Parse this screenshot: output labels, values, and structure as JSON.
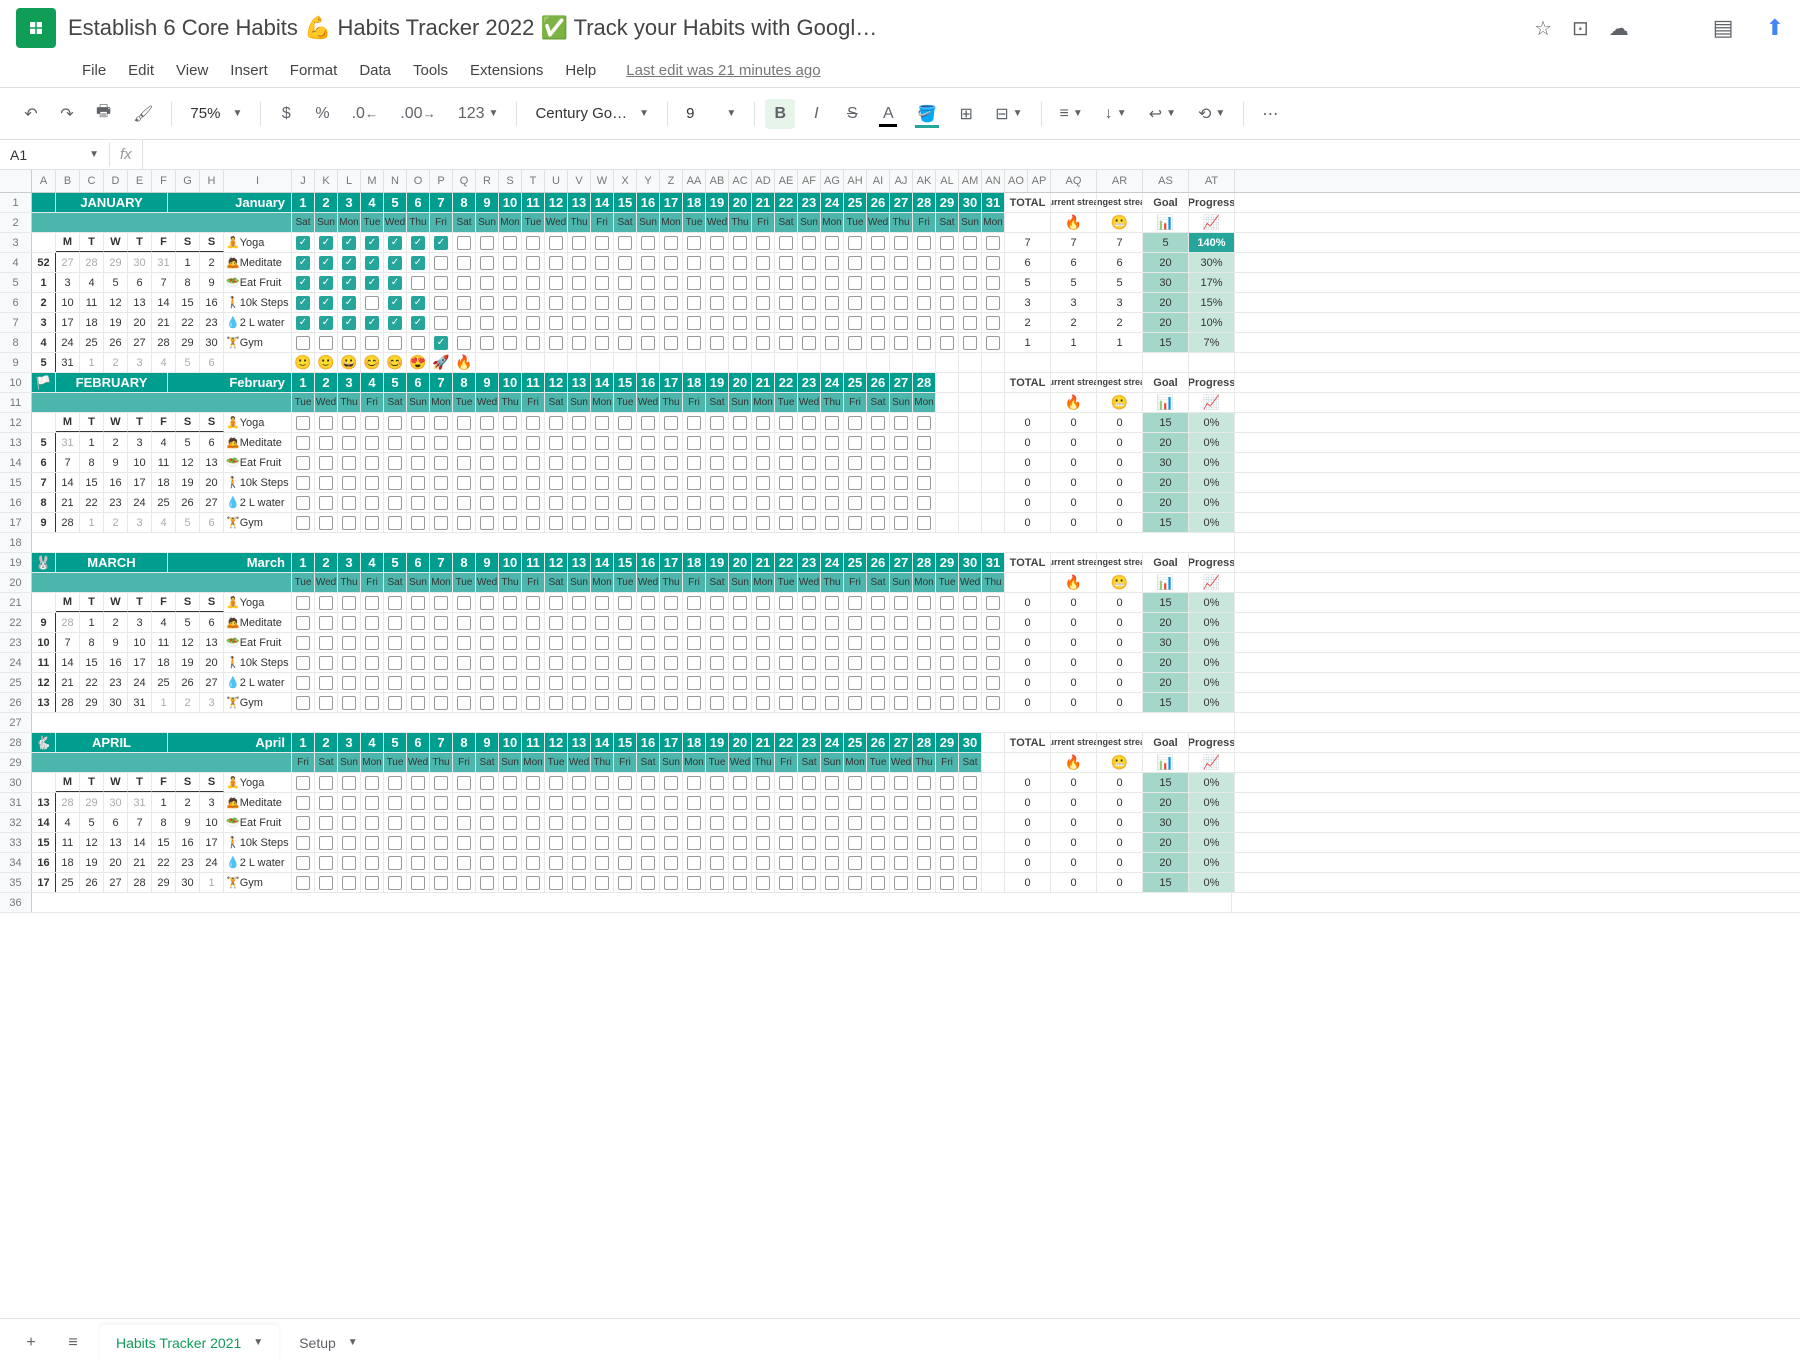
{
  "title": "Establish 6 Core Habits 💪 Habits Tracker 2022 ✅ Track your Habits with Googl…",
  "menu": [
    "File",
    "Edit",
    "View",
    "Insert",
    "Format",
    "Data",
    "Tools",
    "Extensions",
    "Help"
  ],
  "last_edit": "Last edit was 21 minutes ago",
  "toolbar": {
    "zoom": "75%",
    "font": "Century Go…",
    "size": "9",
    "fmt": "123"
  },
  "cell_ref": "A1",
  "columns": [
    "A",
    "B",
    "C",
    "D",
    "E",
    "F",
    "G",
    "H",
    "I",
    "J",
    "K",
    "L",
    "M",
    "N",
    "O",
    "P",
    "Q",
    "R",
    "S",
    "T",
    "U",
    "V",
    "W",
    "X",
    "Y",
    "Z",
    "AA",
    "AB",
    "AC",
    "AD",
    "AE",
    "AF",
    "AG",
    "AH",
    "AI",
    "AJ",
    "AK",
    "AL",
    "AM",
    "AN",
    "AO",
    "AP",
    "AQ",
    "AR",
    "AS",
    "AT"
  ],
  "wk_days": [
    "M",
    "T",
    "W",
    "T",
    "F",
    "S",
    "S"
  ],
  "stat_hdrs": {
    "total": "TOTAL",
    "cur": "current streak",
    "lng": "longest streak",
    "goal": "Goal",
    "prog": "Progress"
  },
  "stat_icons": {
    "cur": "🔥",
    "lng": "😬",
    "goal": "📊",
    "prog": "📈"
  },
  "months": [
    {
      "name": "JANUARY",
      "label": "January",
      "icon": "",
      "days": 31,
      "date_row": [
        "1",
        "2",
        "3",
        "4",
        "5",
        "6",
        "7",
        "8",
        "9",
        "10",
        "11",
        "12",
        "13",
        "14",
        "15",
        "16",
        "17",
        "18",
        "19",
        "20",
        "21",
        "22",
        "23",
        "24",
        "25",
        "26",
        "27",
        "28",
        "29",
        "30",
        "31"
      ],
      "dow_row": [
        "Sat",
        "Sun",
        "Mon",
        "Tue",
        "Wed",
        "Thu",
        "Fri",
        "Sat",
        "Sun",
        "Mon",
        "Tue",
        "Wed",
        "Thu",
        "Fri",
        "Sat",
        "Sun",
        "Mon",
        "Tue",
        "Wed",
        "Thu",
        "Fri",
        "Sat",
        "Sun",
        "Mon",
        "Tue",
        "Wed",
        "Thu",
        "Fri",
        "Sat",
        "Sun",
        "Mon"
      ],
      "cal": [
        [
          "52",
          "27",
          "28",
          "29",
          "30",
          "31",
          "1",
          "2"
        ],
        [
          "1",
          "3",
          "4",
          "5",
          "6",
          "7",
          "8",
          "9"
        ],
        [
          "2",
          "10",
          "11",
          "12",
          "13",
          "14",
          "15",
          "16"
        ],
        [
          "3",
          "17",
          "18",
          "19",
          "20",
          "21",
          "22",
          "23"
        ],
        [
          "4",
          "24",
          "25",
          "26",
          "27",
          "28",
          "29",
          "30"
        ],
        [
          "5",
          "31",
          "1",
          "2",
          "3",
          "4",
          "5",
          "6"
        ]
      ],
      "cal_grey": [
        [
          1,
          2,
          3,
          4,
          5
        ],
        [],
        [],
        [],
        [],
        [
          2,
          3,
          4,
          5,
          6,
          7
        ]
      ],
      "habits": [
        {
          "icon": "🧘",
          "name": "Yoga",
          "checks": 7,
          "total": 7,
          "cur": 7,
          "lng": 7,
          "goal": 5,
          "prog": "140%",
          "hi": true
        },
        {
          "icon": "🙇",
          "name": "Meditate",
          "checks": 6,
          "total": 6,
          "cur": 6,
          "lng": 6,
          "goal": 20,
          "prog": "30%"
        },
        {
          "icon": "🥗",
          "name": "Eat Fruit",
          "checks": 5,
          "total": 5,
          "cur": 5,
          "lng": 5,
          "goal": 30,
          "prog": "17%"
        },
        {
          "icon": "🚶",
          "name": "10k Steps",
          "checks": 6,
          "skip": [
            3
          ],
          "total": 3,
          "cur": 3,
          "lng": 3,
          "goal": 20,
          "prog": "15%"
        },
        {
          "icon": "💧",
          "name": "2 L water",
          "checks": 6,
          "total": 2,
          "cur": 2,
          "lng": 2,
          "goal": 20,
          "prog": "10%"
        },
        {
          "icon": "🏋️",
          "name": "Gym",
          "checks": 7,
          "only": [
            6
          ],
          "total": 1,
          "cur": 1,
          "lng": 1,
          "goal": 15,
          "prog": "7%"
        }
      ],
      "emoji_row": [
        "🙂",
        "🙂",
        "😀",
        "😊",
        "😊",
        "😍",
        "🚀",
        "🔥"
      ]
    },
    {
      "name": "FEBRUARY",
      "label": "February",
      "icon": "🏳️",
      "days": 28,
      "date_row": [
        "1",
        "2",
        "3",
        "4",
        "5",
        "6",
        "7",
        "8",
        "9",
        "10",
        "11",
        "12",
        "13",
        "14",
        "15",
        "16",
        "17",
        "18",
        "19",
        "20",
        "21",
        "22",
        "23",
        "24",
        "25",
        "26",
        "27",
        "28"
      ],
      "dow_row": [
        "Tue",
        "Wed",
        "Thu",
        "Fri",
        "Sat",
        "Sun",
        "Mon",
        "Tue",
        "Wed",
        "Thu",
        "Fri",
        "Sat",
        "Sun",
        "Mon",
        "Tue",
        "Wed",
        "Thu",
        "Fri",
        "Sat",
        "Sun",
        "Mon",
        "Tue",
        "Wed",
        "Thu",
        "Fri",
        "Sat",
        "Sun",
        "Mon"
      ],
      "cal": [
        [
          "5",
          "31",
          "1",
          "2",
          "3",
          "4",
          "5",
          "6"
        ],
        [
          "6",
          "7",
          "8",
          "9",
          "10",
          "11",
          "12",
          "13"
        ],
        [
          "7",
          "14",
          "15",
          "16",
          "17",
          "18",
          "19",
          "20"
        ],
        [
          "8",
          "21",
          "22",
          "23",
          "24",
          "25",
          "26",
          "27"
        ],
        [
          "9",
          "28",
          "1",
          "2",
          "3",
          "4",
          "5",
          "6"
        ]
      ],
      "cal_grey": [
        [
          1
        ],
        [],
        [],
        [],
        [
          2,
          3,
          4,
          5,
          6,
          7
        ]
      ],
      "habits": [
        {
          "icon": "🧘",
          "name": "Yoga",
          "checks": 0,
          "total": 0,
          "cur": 0,
          "lng": 0,
          "goal": 15,
          "prog": "0%"
        },
        {
          "icon": "🙇",
          "name": "Meditate",
          "checks": 0,
          "total": 0,
          "cur": 0,
          "lng": 0,
          "goal": 20,
          "prog": "0%"
        },
        {
          "icon": "🥗",
          "name": "Eat Fruit",
          "checks": 0,
          "total": 0,
          "cur": 0,
          "lng": 0,
          "goal": 30,
          "prog": "0%"
        },
        {
          "icon": "🚶",
          "name": "10k Steps",
          "checks": 0,
          "total": 0,
          "cur": 0,
          "lng": 0,
          "goal": 20,
          "prog": "0%"
        },
        {
          "icon": "💧",
          "name": "2 L water",
          "checks": 0,
          "total": 0,
          "cur": 0,
          "lng": 0,
          "goal": 20,
          "prog": "0%"
        },
        {
          "icon": "🏋️",
          "name": "Gym",
          "checks": 0,
          "total": 0,
          "cur": 0,
          "lng": 0,
          "goal": 15,
          "prog": "0%"
        }
      ]
    },
    {
      "name": "MARCH",
      "label": "March",
      "icon": "🐰",
      "days": 31,
      "date_row": [
        "1",
        "2",
        "3",
        "4",
        "5",
        "6",
        "7",
        "8",
        "9",
        "10",
        "11",
        "12",
        "13",
        "14",
        "15",
        "16",
        "17",
        "18",
        "19",
        "20",
        "21",
        "22",
        "23",
        "24",
        "25",
        "26",
        "27",
        "28",
        "29",
        "30",
        "31"
      ],
      "dow_row": [
        "Tue",
        "Wed",
        "Thu",
        "Fri",
        "Sat",
        "Sun",
        "Mon",
        "Tue",
        "Wed",
        "Thu",
        "Fri",
        "Sat",
        "Sun",
        "Mon",
        "Tue",
        "Wed",
        "Thu",
        "Fri",
        "Sat",
        "Sun",
        "Mon",
        "Tue",
        "Wed",
        "Thu",
        "Fri",
        "Sat",
        "Sun",
        "Mon",
        "Tue",
        "Wed",
        "Thu"
      ],
      "cal": [
        [
          "9",
          "28",
          "1",
          "2",
          "3",
          "4",
          "5",
          "6"
        ],
        [
          "10",
          "7",
          "8",
          "9",
          "10",
          "11",
          "12",
          "13"
        ],
        [
          "11",
          "14",
          "15",
          "16",
          "17",
          "18",
          "19",
          "20"
        ],
        [
          "12",
          "21",
          "22",
          "23",
          "24",
          "25",
          "26",
          "27"
        ],
        [
          "13",
          "28",
          "29",
          "30",
          "31",
          "1",
          "2",
          "3"
        ]
      ],
      "cal_grey": [
        [
          1
        ],
        [],
        [],
        [],
        [
          5,
          6,
          7
        ]
      ],
      "habits": [
        {
          "icon": "🧘",
          "name": "Yoga",
          "checks": 0,
          "total": 0,
          "cur": 0,
          "lng": 0,
          "goal": 15,
          "prog": "0%"
        },
        {
          "icon": "🙇",
          "name": "Meditate",
          "checks": 0,
          "total": 0,
          "cur": 0,
          "lng": 0,
          "goal": 20,
          "prog": "0%"
        },
        {
          "icon": "🥗",
          "name": "Eat Fruit",
          "checks": 0,
          "total": 0,
          "cur": 0,
          "lng": 0,
          "goal": 30,
          "prog": "0%"
        },
        {
          "icon": "🚶",
          "name": "10k Steps",
          "checks": 0,
          "total": 0,
          "cur": 0,
          "lng": 0,
          "goal": 20,
          "prog": "0%"
        },
        {
          "icon": "💧",
          "name": "2 L water",
          "checks": 0,
          "total": 0,
          "cur": 0,
          "lng": 0,
          "goal": 20,
          "prog": "0%"
        },
        {
          "icon": "🏋️",
          "name": "Gym",
          "checks": 0,
          "total": 0,
          "cur": 0,
          "lng": 0,
          "goal": 15,
          "prog": "0%"
        }
      ]
    },
    {
      "name": "APRIL",
      "label": "April",
      "icon": "🐇",
      "days": 30,
      "date_row": [
        "1",
        "2",
        "3",
        "4",
        "5",
        "6",
        "7",
        "8",
        "9",
        "10",
        "11",
        "12",
        "13",
        "14",
        "15",
        "16",
        "17",
        "18",
        "19",
        "20",
        "21",
        "22",
        "23",
        "24",
        "25",
        "26",
        "27",
        "28",
        "29",
        "30"
      ],
      "dow_row": [
        "Fri",
        "Sat",
        "Sun",
        "Mon",
        "Tue",
        "Wed",
        "Thu",
        "Fri",
        "Sat",
        "Sun",
        "Mon",
        "Tue",
        "Wed",
        "Thu",
        "Fri",
        "Sat",
        "Sun",
        "Mon",
        "Tue",
        "Wed",
        "Thu",
        "Fri",
        "Sat",
        "Sun",
        "Mon",
        "Tue",
        "Wed",
        "Thu",
        "Fri",
        "Sat"
      ],
      "cal": [
        [
          "13",
          "28",
          "29",
          "30",
          "31",
          "1",
          "2",
          "3"
        ],
        [
          "14",
          "4",
          "5",
          "6",
          "7",
          "8",
          "9",
          "10"
        ],
        [
          "15",
          "11",
          "12",
          "13",
          "14",
          "15",
          "16",
          "17"
        ],
        [
          "16",
          "18",
          "19",
          "20",
          "21",
          "22",
          "23",
          "24"
        ],
        [
          "17",
          "25",
          "26",
          "27",
          "28",
          "29",
          "30",
          "1"
        ]
      ],
      "cal_grey": [
        [
          1,
          2,
          3,
          4
        ],
        [],
        [],
        [],
        [
          7
        ]
      ],
      "habits": [
        {
          "icon": "🧘",
          "name": "Yoga",
          "checks": 0,
          "total": 0,
          "cur": 0,
          "lng": 0,
          "goal": 15,
          "prog": "0%"
        },
        {
          "icon": "🙇",
          "name": "Meditate",
          "checks": 0,
          "total": 0,
          "cur": 0,
          "lng": 0,
          "goal": 20,
          "prog": "0%"
        },
        {
          "icon": "🥗",
          "name": "Eat Fruit",
          "checks": 0,
          "total": 0,
          "cur": 0,
          "lng": 0,
          "goal": 30,
          "prog": "0%"
        },
        {
          "icon": "🚶",
          "name": "10k Steps",
          "checks": 0,
          "total": 0,
          "cur": 0,
          "lng": 0,
          "goal": 20,
          "prog": "0%"
        },
        {
          "icon": "💧",
          "name": "2 L water",
          "checks": 0,
          "total": 0,
          "cur": 0,
          "lng": 0,
          "goal": 20,
          "prog": "0%"
        },
        {
          "icon": "🏋️",
          "name": "Gym",
          "checks": 0,
          "total": 0,
          "cur": 0,
          "lng": 0,
          "goal": 15,
          "prog": "0%"
        }
      ]
    }
  ],
  "tabs": [
    {
      "name": "Habits Tracker 2021",
      "active": true
    },
    {
      "name": "Setup",
      "active": false
    }
  ]
}
